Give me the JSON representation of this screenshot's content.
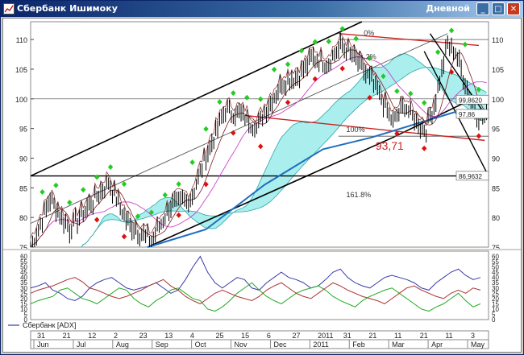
{
  "window": {
    "title": "Сбербанк Ишимоку",
    "period": "Дневной",
    "buttons": {
      "minimize": "_",
      "maximize": "□",
      "close": "✕"
    }
  },
  "colors": {
    "titlebar": "#0a246a",
    "price_bars": "#000000",
    "cloud_fill": "#66e0e0",
    "tenkan": "#7b1f1f",
    "kijun": "#cc44cc",
    "ma": "#1f6fc0",
    "channel": "#000000",
    "resistance": "#cc2222",
    "buy_marker": "#22cc22",
    "sell_marker": "#dd1111",
    "adx_blue": "#3a3aa8",
    "adx_green": "#22aa22",
    "adx_red": "#aa3333"
  },
  "chart_data": [
    {
      "type": "line",
      "panel": "price",
      "ylim": [
        75,
        113
      ],
      "yticks": [
        75,
        80,
        85,
        90,
        95,
        100,
        105,
        110
      ],
      "n_bars": 235,
      "close_keypoints": [
        [
          0,
          75
        ],
        [
          10,
          83
        ],
        [
          20,
          78
        ],
        [
          30,
          82
        ],
        [
          40,
          86
        ],
        [
          50,
          79
        ],
        [
          62,
          76
        ],
        [
          72,
          82
        ],
        [
          82,
          83
        ],
        [
          92,
          92
        ],
        [
          100,
          98
        ],
        [
          110,
          97
        ],
        [
          116,
          95
        ],
        [
          122,
          99
        ],
        [
          130,
          103
        ],
        [
          138,
          104
        ],
        [
          145,
          107
        ],
        [
          152,
          106
        ],
        [
          160,
          109
        ],
        [
          168,
          106
        ],
        [
          175,
          103
        ],
        [
          180,
          100
        ],
        [
          186,
          96
        ],
        [
          192,
          99
        ],
        [
          198,
          96
        ],
        [
          203,
          95
        ],
        [
          208,
          100
        ],
        [
          214,
          109
        ],
        [
          218,
          108
        ],
        [
          222,
          104
        ],
        [
          226,
          100
        ],
        [
          230,
          97
        ],
        [
          234,
          97
        ]
      ],
      "lines": [
        {
          "name": "channel-upper",
          "points": [
            [
              0,
              87
            ],
            [
              170,
              118
            ]
          ]
        },
        {
          "name": "channel-lower",
          "points": [
            [
              60,
              74
            ],
            [
              186,
              93.5
            ],
            [
              230,
              100.5
            ]
          ]
        },
        {
          "name": "channel-middle",
          "points": [
            [
              0,
              79
            ],
            [
              214,
              111
            ]
          ]
        },
        {
          "name": "support-horizontal",
          "points": [
            [
              0,
              87
            ],
            [
              235,
              87
            ]
          ]
        },
        {
          "name": "level-100",
          "points": [
            [
              0,
              100
            ],
            [
              235,
              100
            ]
          ]
        },
        {
          "name": "fib-0",
          "points": [
            [
              158,
              110
            ],
            [
              235,
              110
            ]
          ]
        },
        {
          "name": "fib-100",
          "points": [
            [
              158,
              93.7
            ],
            [
              235,
              93.7
            ]
          ]
        },
        {
          "name": "red-top-trend",
          "points": [
            [
              158,
              111
            ],
            [
              230,
              109
            ]
          ]
        },
        {
          "name": "red-bottom-trend",
          "points": [
            [
              110,
              97.2
            ],
            [
              233,
              93
            ]
          ]
        },
        {
          "name": "down-channel-upper",
          "points": [
            [
              205,
              111
            ],
            [
              234,
              97
            ]
          ]
        },
        {
          "name": "down-channel-lower",
          "points": [
            [
              202,
              108
            ],
            [
              236,
              87
            ]
          ]
        },
        {
          "name": "ma-long",
          "points": [
            [
              60,
              74
            ],
            [
              90,
              78
            ],
            [
              120,
              85.5
            ],
            [
              150,
              91.5
            ],
            [
              175,
              93.5
            ],
            [
              200,
              96
            ],
            [
              220,
              98
            ],
            [
              232,
              98.2
            ]
          ]
        }
      ],
      "annotations": {
        "fib_0": "0%",
        "fib_38": ".2%",
        "fib_100": "100%",
        "fib_161": "161.8%",
        "low_value": "93,71"
      },
      "right_labels": {
        "price_a": "99,8620",
        "price_b": "97,86",
        "price_c": "86,9632"
      }
    },
    {
      "type": "line",
      "panel": "indicator",
      "legend": "Сбербанк [ADX]",
      "ylim": [
        0,
        65
      ],
      "yticks": [
        0,
        5,
        10,
        15,
        20,
        25,
        30,
        35,
        40,
        45,
        50,
        55,
        60
      ],
      "series": [
        {
          "values": [
            30,
            32,
            35,
            28,
            25,
            20,
            18,
            22,
            30,
            35,
            38,
            40,
            35,
            30,
            28,
            30,
            32,
            35,
            30,
            25,
            28,
            38,
            50,
            60,
            45,
            35,
            30,
            35,
            40,
            38,
            30,
            28,
            35,
            40,
            45,
            40,
            38,
            35,
            30,
            32,
            38,
            45,
            48,
            40,
            35,
            32,
            30,
            35,
            40,
            42,
            40,
            38,
            35,
            30,
            28,
            35,
            40,
            45,
            48,
            42,
            38,
            40
          ]
        },
        {
          "values": [
            15,
            18,
            20,
            22,
            28,
            30,
            25,
            20,
            18,
            15,
            20,
            25,
            30,
            28,
            20,
            15,
            12,
            18,
            22,
            28,
            30,
            25,
            20,
            18,
            10,
            8,
            12,
            18,
            25,
            30,
            35,
            28,
            22,
            18,
            15,
            20,
            25,
            28,
            30,
            32,
            28,
            22,
            18,
            15,
            12,
            18,
            22,
            25,
            28,
            30,
            25,
            20,
            15,
            10,
            8,
            12,
            15,
            20,
            25,
            18,
            12,
            15
          ]
        },
        {
          "values": [
            25,
            28,
            30,
            32,
            35,
            38,
            40,
            36,
            30,
            28,
            25,
            22,
            20,
            22,
            25,
            28,
            32,
            35,
            38,
            32,
            28,
            22,
            18,
            15,
            20,
            25,
            28,
            25,
            22,
            20,
            18,
            22,
            28,
            32,
            35,
            30,
            25,
            22,
            20,
            25,
            30,
            35,
            32,
            28,
            25,
            22,
            20,
            18,
            15,
            20,
            25,
            30,
            32,
            28,
            25,
            22,
            20,
            25,
            28,
            25,
            30,
            28
          ]
        }
      ]
    },
    {
      "type": "axis",
      "panel": "time-axis",
      "day_ticks": [
        "31",
        "21",
        "12",
        "2",
        "23",
        "13",
        "4",
        "25",
        "15",
        "6",
        "27",
        "2011",
        "31",
        "21",
        "11",
        "21",
        "11",
        "3"
      ],
      "month_ticks": [
        "Jun",
        "Jul",
        "Aug",
        "Sep",
        "Oct",
        "Nov",
        "Dec",
        "2011",
        "Feb",
        "Mar",
        "Apr",
        "May"
      ]
    }
  ]
}
